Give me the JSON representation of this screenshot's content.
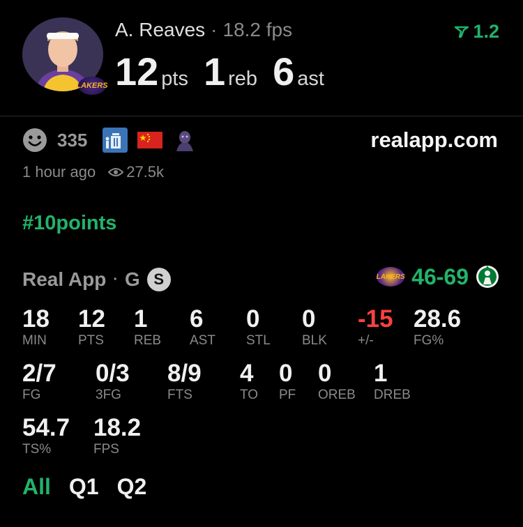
{
  "player": {
    "name": "A. Reaves",
    "separator": "·",
    "fps": "18.2 fps",
    "team_badge": "LAKERS",
    "statline": [
      {
        "value": "12",
        "unit": "pts"
      },
      {
        "value": "1",
        "unit": "reb"
      },
      {
        "value": "6",
        "unit": "ast"
      }
    ]
  },
  "score_delta": "1.2",
  "social": {
    "likes": "335",
    "site": "realapp.com",
    "time_ago": "1 hour ago",
    "views": "27.5k"
  },
  "hashtag": "#10points",
  "game": {
    "source": "Real App",
    "dot": "·",
    "position": "G",
    "badge": "S",
    "score": "46-69",
    "home_logo_text": "LAKERS"
  },
  "stats": {
    "row1": [
      {
        "value": "18",
        "label": "MIN"
      },
      {
        "value": "12",
        "label": "PTS"
      },
      {
        "value": "1",
        "label": "REB"
      },
      {
        "value": "6",
        "label": "AST"
      },
      {
        "value": "0",
        "label": "STL"
      },
      {
        "value": "0",
        "label": "BLK"
      },
      {
        "value": "-15",
        "label": "+/-"
      },
      {
        "value": "28.6",
        "label": "FG%"
      }
    ],
    "row2": [
      {
        "value": "2/7",
        "label": "FG"
      },
      {
        "value": "0/3",
        "label": "3FG"
      },
      {
        "value": "8/9",
        "label": "FTS"
      },
      {
        "value": "4",
        "label": "TO"
      },
      {
        "value": "0",
        "label": "PF"
      },
      {
        "value": "0",
        "label": "OREB"
      },
      {
        "value": "1",
        "label": "DREB"
      }
    ],
    "row3": [
      {
        "value": "54.7",
        "label": "TS%"
      },
      {
        "value": "18.2",
        "label": "FPS"
      }
    ]
  },
  "quarters": [
    "All",
    "Q1",
    "Q2"
  ],
  "colors": {
    "accent_green": "#22b36b",
    "negative_red": "#ff4040",
    "background": "#000000"
  }
}
